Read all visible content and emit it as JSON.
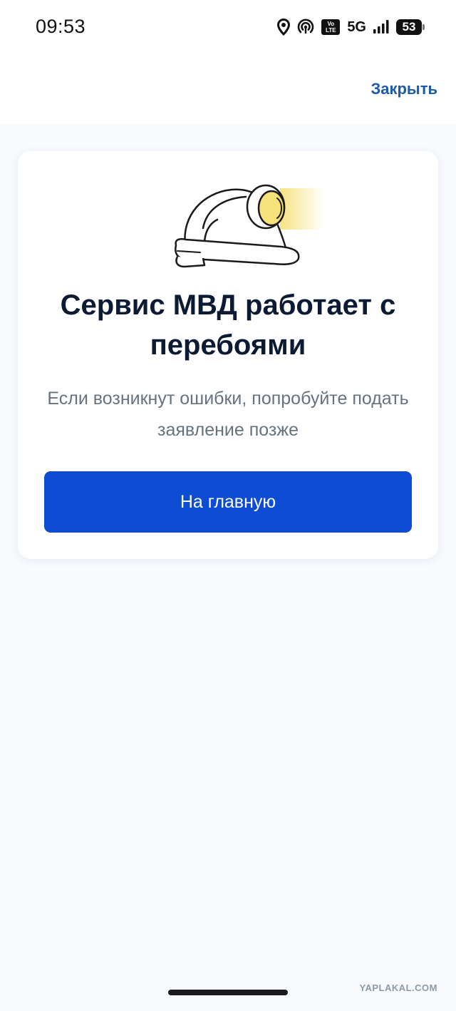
{
  "status_bar": {
    "time": "09:53",
    "volte_line1": "Vo",
    "volte_line2": "LTE",
    "network": "5G",
    "battery": "53",
    "icons": [
      "location-icon",
      "hotspot-icon",
      "volte-icon",
      "signal-icon",
      "battery-icon"
    ]
  },
  "header": {
    "close_label": "Закрыть"
  },
  "card": {
    "illustration": "hard-hat-with-headlamp",
    "title": "Сервис МВД работает с перебоями",
    "subtitle": "Если возникнут ошибки, попробуйте подать заявление позже",
    "button_label": "На главную"
  },
  "colors": {
    "accent": "#0d4cd3",
    "link": "#1c5ba8",
    "title": "#0c1b33",
    "subtitle": "#66727f",
    "background": "#f8fafd",
    "lamp_light": "#f6e27a"
  },
  "watermark": "YAPLAKAL.COM"
}
